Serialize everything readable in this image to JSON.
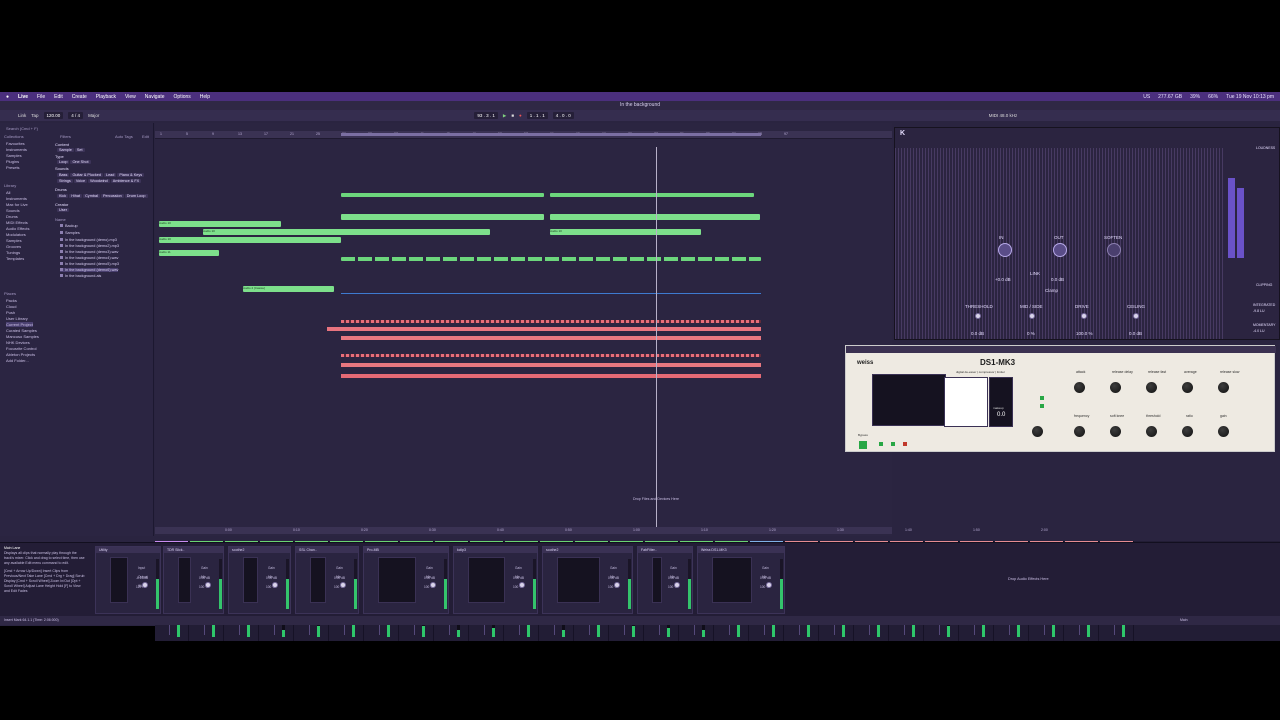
{
  "menubar": {
    "apple": "",
    "app": "Live",
    "items": [
      "File",
      "Edit",
      "Create",
      "Playback",
      "View",
      "Navigate",
      "Options",
      "Help"
    ],
    "right": [
      "US",
      "277.67 GB",
      "39%",
      "66%",
      "Tue 19 Nov 10:13 pm"
    ]
  },
  "app": {
    "title": "In the background",
    "tempo": "120.00",
    "time_sig": "4 / 4",
    "position": "93 . 3 . 1",
    "loop_start": "1 . 1 . 1",
    "loop_end": "4 . 0 . 0",
    "key": "Major",
    "cpu": "MIDI 48.0 kHz",
    "link": "Link",
    "tap": "Tap"
  },
  "browser": {
    "search": "Search (Cmd + F)",
    "filters": "Filters",
    "autotags": "Auto Tags",
    "edit": "Edit",
    "collections_h": "Collections",
    "collections": [
      "Favourites",
      "Instruments",
      "Samples",
      "Plugins",
      "Presets"
    ],
    "library_h": "Library",
    "library": [
      "All",
      "Instruments",
      "Max for Live",
      "Sounds",
      "Drums",
      "MIDI Effects",
      "Audio Effects",
      "Modulators",
      "Samples",
      "Grooves",
      "Tunings",
      "Templates"
    ],
    "places_h": "Places",
    "places": [
      "Packs",
      "Cloud",
      "Push",
      "User Library",
      "Current Project",
      "Curated Samples",
      "Mancuso Samples",
      "NHK Devices",
      "Focusrite Control",
      "Ableton Projects",
      "Add Folder..."
    ],
    "content": "Content",
    "content_vals": [
      "Sample",
      "Set"
    ],
    "type": "Type",
    "type_vals": [
      "Loop",
      "One Shot"
    ],
    "sounds": "Sounds",
    "sounds_vals": [
      "Bass",
      "Guitar & Plucked",
      "Lead",
      "Piano & Keys",
      "Strings",
      "Voice",
      "Woodwind",
      "Ambience & FX"
    ],
    "drums": "Drums",
    "drums_vals": [
      "Kick",
      "Hihat",
      "Cymbal",
      "Percussion",
      "Drum Loop"
    ],
    "creator": "Creator",
    "user": "User",
    "name_h": "Name",
    "folders": [
      "Backup",
      "Samples"
    ],
    "files": [
      "In the background (demo).mp3",
      "In the background (demo2).mp3",
      "In the background (demo3).wav",
      "In the background (demo4).wav",
      "In the background (demo5).mp3",
      "In the background (demo6).wav",
      "In the background.als"
    ]
  },
  "arrangement": {
    "ruler": [
      "1",
      "5",
      "9",
      "13",
      "17",
      "21",
      "25",
      "29",
      "33",
      "37",
      "41",
      "45",
      "49",
      "53",
      "57",
      "61",
      "65",
      "69",
      "73",
      "77",
      "81",
      "85",
      "89",
      "93",
      "97"
    ],
    "clips": [
      "Audio 10",
      "Audio 10",
      "Audio 10",
      "Audio 10",
      "Audio 11",
      "Audio 2 [Cassie]",
      "Audio 10"
    ],
    "drop": "Drop Files and Devices Here",
    "timeline": [
      "0:00",
      "0:10",
      "0:20",
      "0:30",
      "0:40",
      "0:50",
      "1:00",
      "1:10",
      "1:20",
      "1:30",
      "1:40",
      "1:50",
      "2:00"
    ]
  },
  "mixer": {
    "strips": [
      {
        "name": "Fx",
        "color": "#c98cf1",
        "io": [
          "Audio To",
          "Main"
        ],
        "val": "-1.4",
        "num": "1",
        "m": 0.4
      },
      {
        "name": "Melody",
        "color": "#6ad472",
        "io": [
          "Audio To",
          "Main"
        ],
        "val": "-7.9",
        "num": "2",
        "m": 0.55
      },
      {
        "name": "6 Group",
        "color": "#6ad472",
        "io": [
          "Audio To",
          "Melody"
        ],
        "val": "-27.7",
        "num": "3",
        "m": 0.35
      },
      {
        "name": "7 Audio",
        "color": "#6ad472",
        "io": [
          "Audio From",
          "Ext. In",
          "Monitor",
          "Audio To",
          "Melody"
        ],
        "val": "-inf",
        "num": "4",
        "m": 0.2
      },
      {
        "name": "12 Audio",
        "color": "#6ad472",
        "io": [
          "Audio From",
          "Resampling",
          "Monitor",
          "Audio To",
          "Melody"
        ],
        "val": "-25.5",
        "num": "5",
        "m": 0.3
      },
      {
        "name": "14 Audio Preview",
        "color": "#6ad472",
        "io": [
          "Audio From",
          "Ext. In",
          "1/2",
          "Audio To",
          "Melody"
        ],
        "val": "-inf",
        "num": "6",
        "m": 0.45
      },
      {
        "name": "15 Group",
        "color": "#6ad472",
        "io": [
          "Audio To",
          "Melody"
        ],
        "val": "-inf",
        "num": "7",
        "m": 0.5
      },
      {
        "name": "16 Audio",
        "color": "#6ad472",
        "io": [
          "Audio From",
          "Ext. In",
          "3/4",
          "Audio To",
          "Melody"
        ],
        "val": "-27.0",
        "num": "8",
        "m": 0.3
      },
      {
        "name": "18 Audio",
        "color": "#6ad472",
        "io": [
          "Audio From",
          "Ext. In",
          "Monitor",
          "Audio To",
          "Melody"
        ],
        "val": "-17.0",
        "num": "9",
        "m": 0.2
      },
      {
        "name": "20 Audio",
        "color": "#6ad472",
        "io": [
          "Audio From",
          "Ext. In",
          "Monitor",
          "Audio To",
          "Melody"
        ],
        "val": "-inf",
        "num": "10",
        "m": 0.25
      },
      {
        "name": "22 Audio",
        "color": "#6ad472",
        "io": [
          "Audio From",
          "Ext. In",
          "Monitor",
          "Audio To",
          "Melody"
        ],
        "val": "-inf",
        "num": "11",
        "m": 0.5
      },
      {
        "name": "24 Audio",
        "color": "#6ad472",
        "io": [
          "Audio From",
          "Ext. In",
          "Monitor",
          "Audio To",
          "Melody"
        ],
        "val": "-inf",
        "num": "12",
        "m": 0.2
      },
      {
        "name": "26 Group",
        "color": "#6ad472",
        "io": [
          "Audio To",
          "Melody"
        ],
        "val": "-8.2",
        "num": "13",
        "m": 0.7
      },
      {
        "name": "26 Audio (2024-1",
        "color": "#6ad472",
        "io": [
          "MIDI From",
          "All Ins",
          "All Channels",
          "Audio To",
          "Melody"
        ],
        "val": "-14.9",
        "num": "14",
        "m": 0.3
      },
      {
        "name": "28 Audio",
        "color": "#6ad472",
        "io": [
          "Audio From",
          "Ext. In",
          "Monitor",
          "Audio To",
          "Melody"
        ],
        "val": "-inf",
        "num": "15",
        "m": 0.25
      },
      {
        "name": "29 Group",
        "color": "#6ad472",
        "io": [
          "Audio To",
          "Melody"
        ],
        "val": "-inf",
        "num": "16",
        "m": 0.2
      },
      {
        "name": "30 Audio 2 [Cassie]",
        "color": "#6ad472",
        "io": [
          "Audio From",
          "Ext. In",
          "Monitor",
          "Audio To",
          "Melody"
        ],
        "val": "-inf",
        "num": "17",
        "m": 0.4
      },
      {
        "name": "Bus",
        "color": "#7fb1e6",
        "io": [
          "Audio To",
          "Main"
        ],
        "val": "-4.2",
        "num": "18",
        "m": 0.6
      },
      {
        "name": "Drums",
        "color": "#e58c92",
        "io": [
          "Audio To",
          "Main"
        ],
        "val": "-6.6",
        "num": "19",
        "m": 0.8
      },
      {
        "name": "34 Mancini Mus",
        "color": "#e58c92",
        "io": [
          "Audio From",
          "Ext. In",
          "Monitor",
          "Audio To",
          "Drums"
        ],
        "val": "-inf",
        "num": "20",
        "m": 0.6
      },
      {
        "name": "35 Audio",
        "color": "#e58c92",
        "io": [
          "Audio From",
          "Ext. In",
          "Monitor",
          "Audio To",
          "Drums"
        ],
        "val": "-inf",
        "num": "21",
        "m": 0.5
      },
      {
        "name": "36 Audio",
        "color": "#e58c92",
        "io": [
          "Audio From",
          "Ext. In",
          "Monitor",
          "Audio To",
          "Drums"
        ],
        "val": "-inf",
        "num": "22",
        "m": 0.55
      },
      {
        "name": "37 Audio",
        "color": "#e58c92",
        "io": [
          "Audio From",
          "Ext. In",
          "Monitor",
          "Audio To",
          "Drums"
        ],
        "val": "-inf",
        "num": "23",
        "m": 0.3
      },
      {
        "name": "38 Audio",
        "color": "#e58c92",
        "io": [
          "Audio From",
          "Ext. In",
          "Monitor",
          "Audio To",
          "Drums"
        ],
        "val": "-26.0",
        "num": "24",
        "m": 0.4
      },
      {
        "name": "39 Audio",
        "color": "#e58c92",
        "io": [
          "Audio From",
          "Ext. In",
          "Monitor",
          "Audio To",
          "Drums"
        ],
        "val": "-inf",
        "num": "25",
        "m": 0.45
      },
      {
        "name": "40 Audio",
        "color": "#e58c92",
        "io": [
          "Audio From",
          "Ext. In",
          "Monitor",
          "Audio To",
          "Drums"
        ],
        "val": "-inf",
        "num": "26",
        "m": 0.35
      },
      {
        "name": "41 Audio",
        "color": "#e58c92",
        "io": [
          "Audio From",
          "Ext. In",
          "Monitor",
          "Audio To",
          "Drums"
        ],
        "val": "-23.6",
        "num": "27",
        "m": 0.5
      },
      {
        "name": "42 MIDI",
        "color": "#e58c92",
        "io": [
          "MIDI From",
          "All Ins",
          "All Channels",
          "Audio To",
          "Drums"
        ],
        "val": "-inf",
        "num": "28",
        "m": 0.7
      }
    ],
    "cue": "Cue Out",
    "cue_val": "1/2",
    "main": "Main Out",
    "main_val": "1/2"
  },
  "devices": {
    "info_title": "Main Lane",
    "info": "Displays all clips that normally play through the track's mixer. Click and drag to select time, then use any available Edit menu command to edit.",
    "info_keys": "[Cmd + Arrow Up/Down] Insert Clips from Previous/Next Take Lane [Cmd + Drg + Drag] Scrub Display [Cmd + Scroll Wheel] Zoom In/Out [Opt + Scroll Wheel] Adjust Lane Height Hold [F] to View and Edit Fades",
    "chain": [
      {
        "name": "Utility",
        "p": [
          "Input",
          "Output",
          "Width",
          "Mono",
          "Bass Mono",
          "Gain",
          "Balance"
        ],
        "v": [
          "-6.13 dB",
          "120 Hz"
        ]
      },
      {
        "name": "TDR Slick..",
        "p": [
          "Gain",
          "Mix"
        ],
        "v": [
          "0.00 dB",
          "100 %"
        ]
      },
      {
        "name": "soothe2",
        "p": [
          "Gain",
          "Mix"
        ],
        "v": [
          "0.00 dB",
          "100 %"
        ]
      },
      {
        "name": "SSL Chan..",
        "p": [
          "Gain",
          "Mix"
        ],
        "v": [
          "0.00 dB",
          "100 %"
        ]
      },
      {
        "name": "Pro-MB",
        "p": [
          "Gain",
          "Mix"
        ],
        "v": [
          "0.00 dB",
          "100 %"
        ]
      },
      {
        "name": "kclip3",
        "p": [
          "Gain",
          "Mix"
        ],
        "v": [
          "0.00 dB",
          "100 %"
        ]
      },
      {
        "name": "soothe2",
        "p": [
          "Gain",
          "Mix"
        ],
        "v": [
          "0.00 dB",
          "100 %"
        ]
      },
      {
        "name": "FabFilter..",
        "p": [
          "Gain",
          "Mix"
        ],
        "v": [
          "0.00 dB",
          "100 %"
        ]
      },
      {
        "name": "Weiss DS1-MK3",
        "p": [
          "Gain",
          "Mix"
        ],
        "v": [
          "0.00 dB",
          "100 %"
        ]
      }
    ],
    "drop": "Drop Audio Effects Here"
  },
  "status": {
    "left": "Insert Mark 64.1.1 (Time: 2:06:000)",
    "right": "Main"
  },
  "plugin1": {
    "logo": "K",
    "name": "KClip3",
    "labels": [
      "IN",
      "OUT",
      "SOFTEN",
      "THRESHOLD",
      "MID / SIDE",
      "DRIVE",
      "CEILING",
      "LINK",
      "Clamp",
      "LOUDNESS",
      "CLIPPING",
      "INTEGRATED",
      "MOMENTARY"
    ],
    "vals": [
      "+0.0 dB",
      "0.0 dB",
      "0 %",
      "100.0 %",
      "0.0 dB",
      "-9.8 LU",
      "-4.0 LU",
      "+0.0 dB"
    ]
  },
  "plugin2": {
    "brand": "weiss",
    "name": "DS1-MK3",
    "sub": "digital de-esser | compressor | limiter",
    "labels": [
      "attack",
      "release delay",
      "release fast",
      "average",
      "release slow",
      "hold",
      "frequency",
      "soft knee",
      "threshold",
      "ratio",
      "gain",
      "makeup",
      "look ahead"
    ],
    "makeup_val": "0.0",
    "pres": [
      "Bypass"
    ]
  }
}
